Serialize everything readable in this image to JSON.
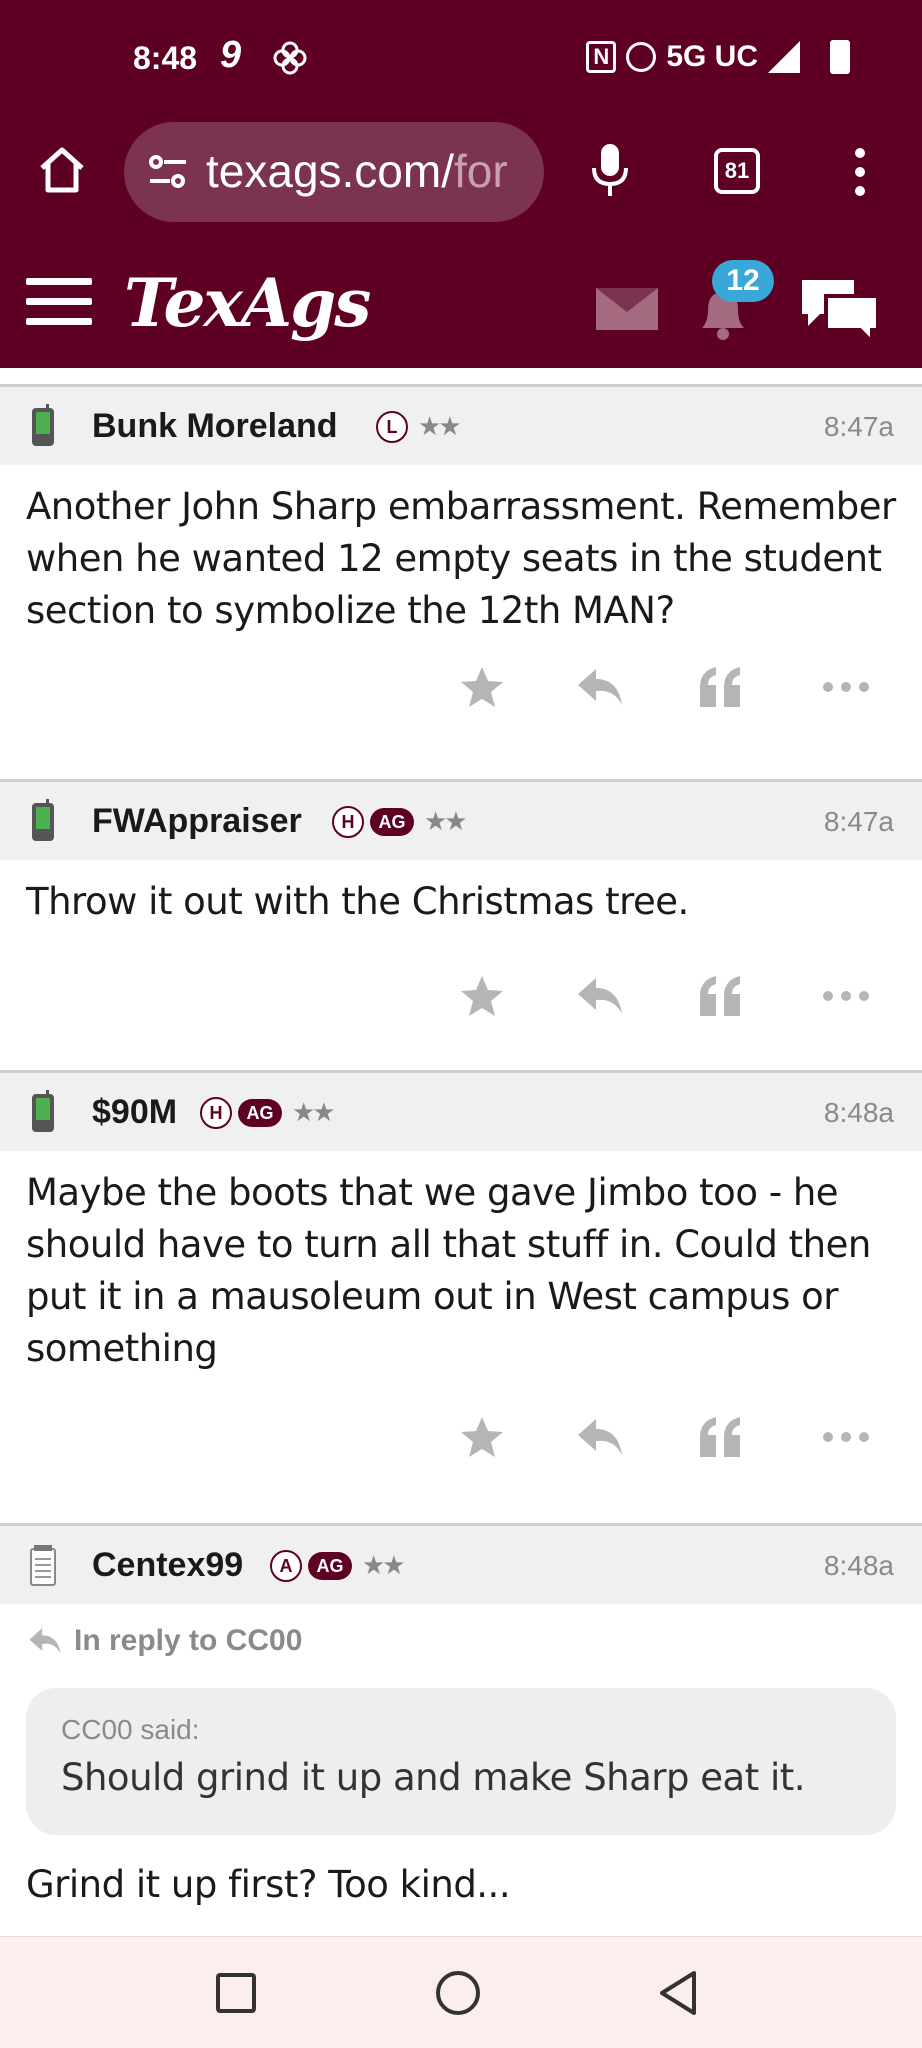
{
  "status_bar": {
    "time": "8:48",
    "network": "5G UC"
  },
  "browser": {
    "url_visible": "texags.com/",
    "url_faded": "for",
    "tab_count": "81"
  },
  "site_header": {
    "logo": "TexAgs",
    "notification_count": "12"
  },
  "posts": [
    {
      "username": "Bunk Moreland",
      "badges": [
        "L"
      ],
      "ag": false,
      "stars": "★★",
      "time": "8:47a",
      "device_icon": "phone-icon",
      "body": "Another John Sharp embarrassment. Remember when he wanted 12 empty seats in the student section to symbolize the 12th MAN?"
    },
    {
      "username": "FWAppraiser",
      "badges": [
        "H"
      ],
      "ag": true,
      "ag_label": "AG",
      "stars": "★★",
      "time": "8:47a",
      "device_icon": "phone-icon",
      "body": "Throw it out with the Christmas tree."
    },
    {
      "username": "$90M",
      "badges": [
        "H"
      ],
      "ag": true,
      "ag_label": "AG",
      "stars": "★★",
      "time": "8:48a",
      "device_icon": "phone-icon",
      "body": "Maybe the boots that we gave Jimbo too - he should have to turn all that stuff in. Could then put it in a mausoleum out in West campus or something"
    },
    {
      "username": "Centex99",
      "badges": [
        "A"
      ],
      "ag": true,
      "ag_label": "AG",
      "stars": "★★",
      "time": "8:48a",
      "device_icon": "notepad-icon",
      "reply_to": "In reply to CC00",
      "quote_author": "CC00 said:",
      "quote_text": "Should grind it up and make Sharp eat it.",
      "body": "Grind it up first? Too kind..."
    }
  ],
  "colors": {
    "maroon": "#5d0024",
    "badge_blue": "#3aa7d9",
    "action_gray": "#b5b5b5"
  }
}
